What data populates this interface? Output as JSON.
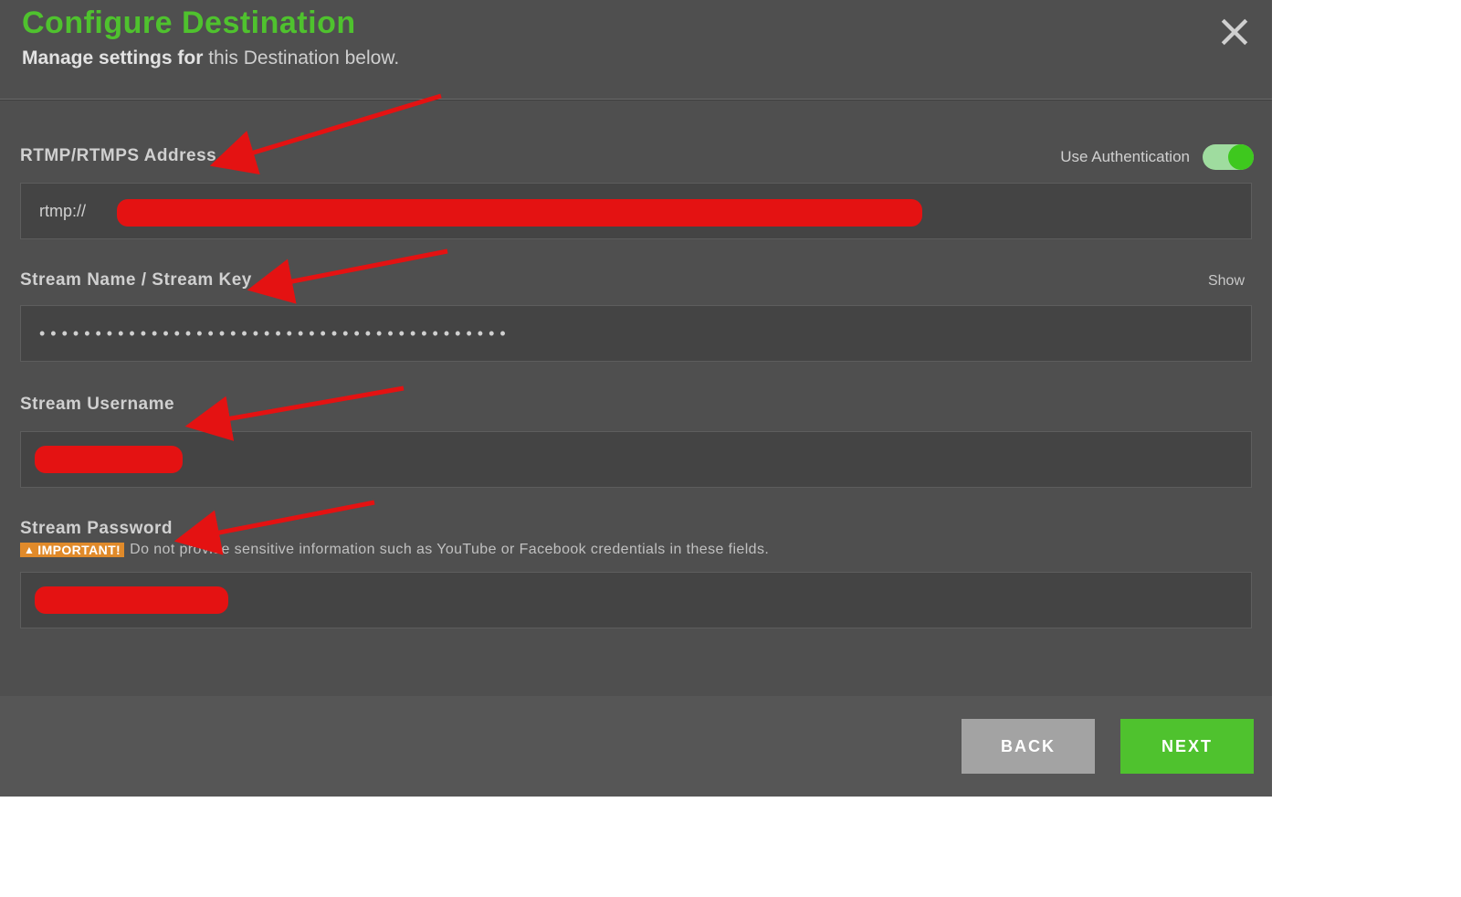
{
  "header": {
    "title": "Configure Destination",
    "subtitle_bold": "Manage settings for",
    "subtitle_rest": " this Destination below."
  },
  "auth": {
    "label": "Use Authentication",
    "enabled": true
  },
  "fields": {
    "rtmp": {
      "label": "RTMP/RTMPS Address",
      "prefix": "rtmp://",
      "value_redacted": true
    },
    "streamkey": {
      "label": "Stream Name / Stream Key",
      "show_label": "Show",
      "masked_value": "••••••••••••••••••••••••••••••••••••••••••"
    },
    "username": {
      "label": "Stream Username",
      "value_redacted": true
    },
    "password": {
      "label": "Stream Password",
      "value_redacted": true
    }
  },
  "important": {
    "tag": "IMPORTANT!",
    "text": "Do not provide sensitive information such as YouTube or Facebook credentials in these fields."
  },
  "footer": {
    "back": "BACK",
    "next": "NEXT"
  }
}
